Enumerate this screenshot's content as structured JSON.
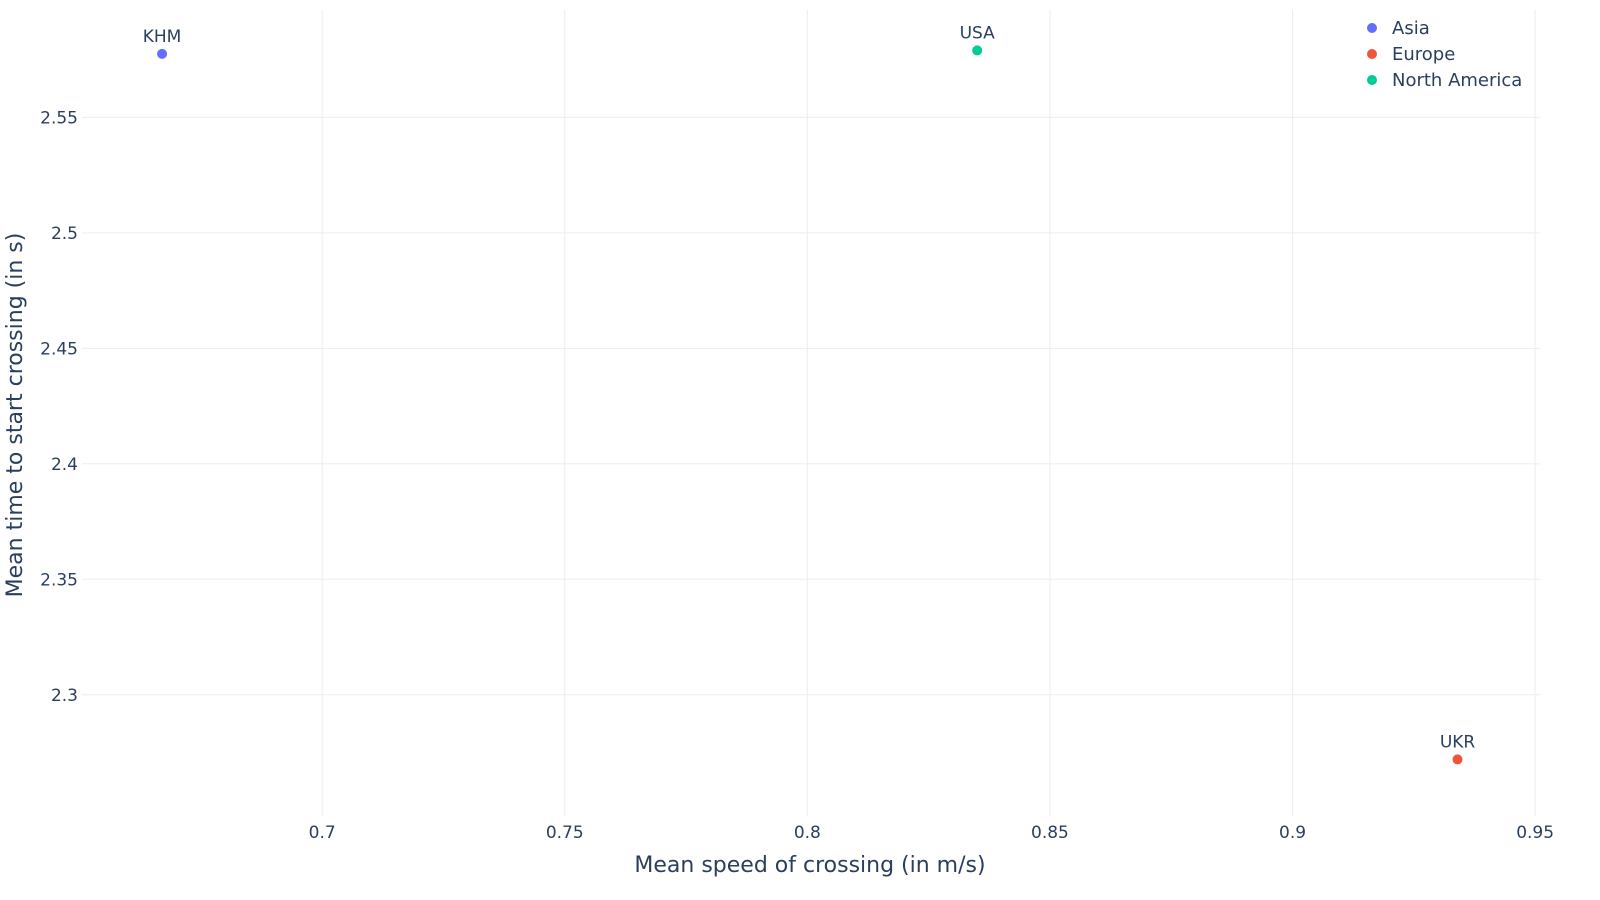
{
  "chart_data": {
    "type": "scatter",
    "title": "",
    "xlabel": "Mean speed of crossing (in m/s)",
    "ylabel": "Mean time to start crossing (in s)",
    "xlim": [
      0.6505,
      0.951
    ],
    "ylim": [
      2.2475,
      2.5965
    ],
    "x_ticks": [
      0.7,
      0.75,
      0.8,
      0.85,
      0.9,
      0.95
    ],
    "x_tick_labels": [
      "0.7",
      "0.75",
      "0.8",
      "0.85",
      "0.9",
      "0.95"
    ],
    "y_ticks": [
      2.3,
      2.35,
      2.4,
      2.45,
      2.5,
      2.55
    ],
    "y_tick_labels": [
      "2.3",
      "2.35",
      "2.4",
      "2.45",
      "2.5",
      "2.55"
    ],
    "grid": true,
    "legend_position": "top-right",
    "series": [
      {
        "name": "Asia",
        "color": "#636efa",
        "points": [
          {
            "x": 0.667,
            "y": 2.5775,
            "label": "KHM"
          }
        ]
      },
      {
        "name": "Europe",
        "color": "#ef553b",
        "points": [
          {
            "x": 0.934,
            "y": 2.272,
            "label": "UKR"
          }
        ]
      },
      {
        "name": "North America",
        "color": "#00cc96",
        "points": [
          {
            "x": 0.835,
            "y": 2.579,
            "label": "USA"
          }
        ]
      }
    ]
  }
}
